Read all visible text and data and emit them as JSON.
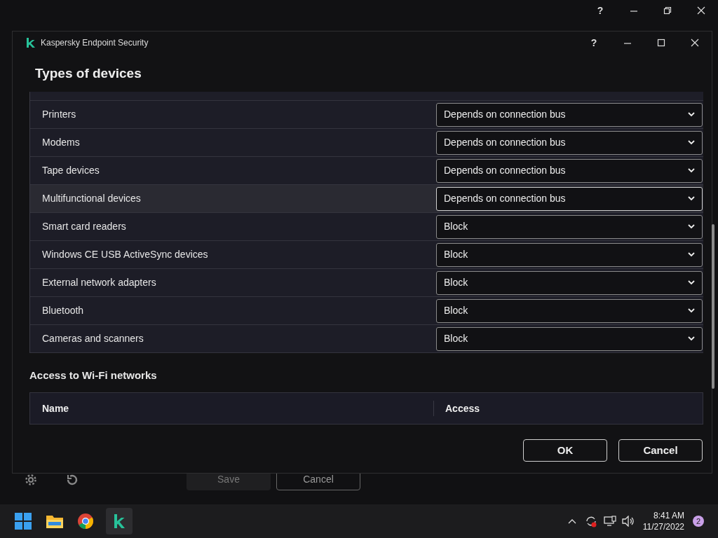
{
  "background_window": {
    "buttons": [
      {
        "label": "Save",
        "disabled": true
      },
      {
        "label": "Cancel",
        "disabled": false
      }
    ]
  },
  "dialog": {
    "title": "Kaspersky Endpoint Security",
    "heading": "Types of devices",
    "device_rows": [
      {
        "name": "Printers",
        "access": "Depends on connection bus",
        "hovered": false
      },
      {
        "name": "Modems",
        "access": "Depends on connection bus",
        "hovered": false
      },
      {
        "name": "Tape devices",
        "access": "Depends on connection bus",
        "hovered": false
      },
      {
        "name": "Multifunctional devices",
        "access": "Depends on connection bus",
        "hovered": true
      },
      {
        "name": "Smart card readers",
        "access": "Block",
        "hovered": false
      },
      {
        "name": "Windows CE USB ActiveSync devices",
        "access": "Block",
        "hovered": false
      },
      {
        "name": "External network adapters",
        "access": "Block",
        "hovered": false
      },
      {
        "name": "Bluetooth",
        "access": "Block",
        "hovered": false
      },
      {
        "name": "Cameras and scanners",
        "access": "Block",
        "hovered": false
      }
    ],
    "wifi_section": {
      "title": "Access to Wi-Fi networks",
      "columns": [
        "Name",
        "Access"
      ]
    },
    "buttons": [
      "OK",
      "Cancel"
    ]
  },
  "outer_help": "?",
  "dialog_help": "?",
  "taskbar": {
    "time": "8:41 AM",
    "date": "11/27/2022",
    "notification_count": "2"
  }
}
